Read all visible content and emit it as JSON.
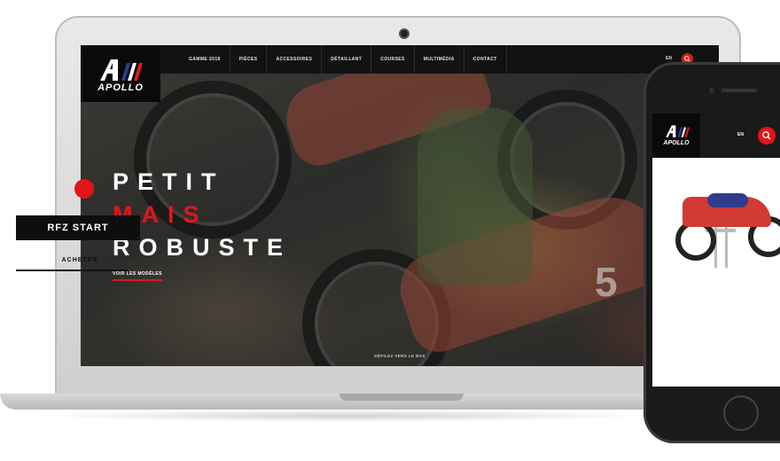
{
  "colors": {
    "accent": "#e3151a",
    "nav_bg": "#121212",
    "logo_bg": "#0a0a0a"
  },
  "brand": {
    "name": "APOLLO"
  },
  "desktop": {
    "nav_items": [
      "GAMME 2018",
      "PIÈCES",
      "ACCESSOIRES",
      "DÉTAILLANT",
      "COURSES",
      "MULTIMÉDIA",
      "CONTACT"
    ],
    "language": "EN",
    "search_icon": "search-icon",
    "hero": {
      "line1": "PETIT",
      "line2": "MAIS",
      "line3": "ROBUSTE",
      "cta": "VOIR LES MODÈLES",
      "scroll_hint": "DÉFILEZ VERS LE BAS",
      "plate_number": "5"
    }
  },
  "mobile": {
    "language": "EN",
    "product_name": "RFZ START",
    "buy_label": "ACHETER"
  }
}
